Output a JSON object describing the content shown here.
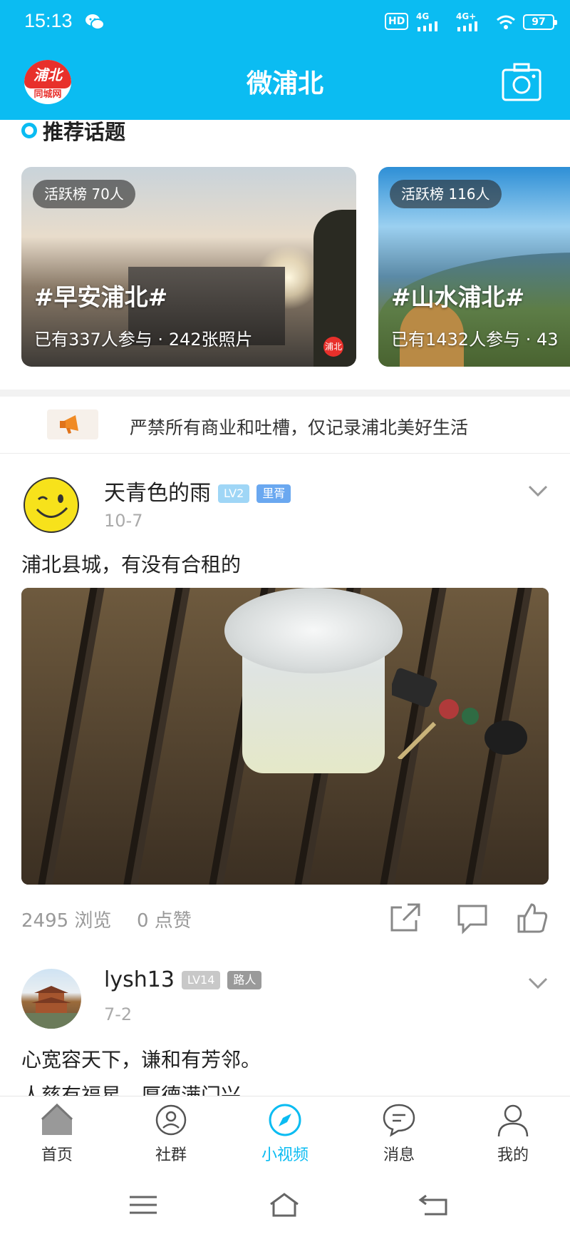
{
  "status_bar": {
    "time": "15:13",
    "hd_label": "HD",
    "sig1_label": "4G",
    "sig2_label": "4G+",
    "battery": "97"
  },
  "header": {
    "logo_top": "浦北",
    "logo_bottom": "同城网",
    "title": "微浦北",
    "camera_icon": "camera-icon"
  },
  "topics": {
    "section_title": "推荐话题",
    "cards": [
      {
        "badge": "活跃榜 70人",
        "tag": "#早安浦北#",
        "stat": "已有337人参与 · 242张照片",
        "watermark": "浦北"
      },
      {
        "badge": "活跃榜 116人",
        "tag": "#山水浦北#",
        "stat": "已有1432人参与 · 43"
      }
    ]
  },
  "notice": {
    "text": "严禁所有商业和吐槽，仅记录浦北美好生活",
    "icon": "megaphone-icon"
  },
  "posts": [
    {
      "username": "天青色的雨",
      "level": "LV2",
      "role": "里胥",
      "date": "10-7",
      "text": "浦北县城，有没有合租的",
      "views": "2495 浏览",
      "likes": "0 点赞"
    },
    {
      "username": "lysh13",
      "level": "LV14",
      "role": "路人",
      "date": "7-2",
      "text": "心宽容天下，谦和有芳邻。",
      "text2": "人慈有福星，厚德满门兴"
    }
  ],
  "tabbar": {
    "items": [
      {
        "label": "首页",
        "icon": "home-icon"
      },
      {
        "label": "社群",
        "icon": "community-icon"
      },
      {
        "label": "小视频",
        "icon": "compass-icon",
        "active": true
      },
      {
        "label": "消息",
        "icon": "message-icon"
      },
      {
        "label": "我的",
        "icon": "profile-icon"
      }
    ]
  },
  "colors": {
    "brand": "#0bbcf2",
    "logo_red": "#e8302b",
    "lv_blue": "#9fd6f6",
    "role_blue": "#6aa8f0",
    "lv_gray": "#c8c8c8",
    "role_gray": "#9a9a9a"
  }
}
